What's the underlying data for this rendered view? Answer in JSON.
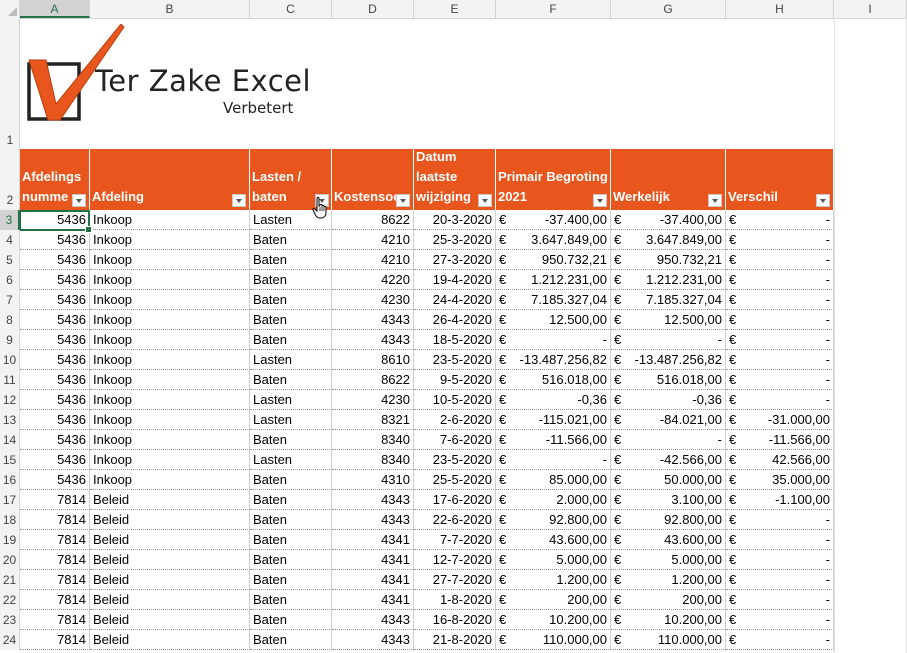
{
  "columns": [
    "A",
    "B",
    "C",
    "D",
    "E",
    "F",
    "G",
    "H",
    "I"
  ],
  "logo": {
    "title": "Ter Zake Excel",
    "subtitle": "Verbetert"
  },
  "headers": [
    "Afdelings\nnumme",
    "Afdeling",
    "Lasten /\nbaten",
    "Kostensoo",
    "Datum\nlaatste\nwijziging",
    "Primair Begroting\n2021",
    "Werkelijk",
    "Verschil"
  ],
  "rows": [
    {
      "n": "3",
      "afdnr": "5436",
      "afd": "Inkoop",
      "lb": "Lasten",
      "ks": "8622",
      "datum": "20-3-2020",
      "f": "-37.400,00",
      "g": "-37.400,00",
      "h": "-"
    },
    {
      "n": "4",
      "afdnr": "5436",
      "afd": "Inkoop",
      "lb": "Baten",
      "ks": "4210",
      "datum": "25-3-2020",
      "f": "3.647.849,00",
      "g": "3.647.849,00",
      "h": "-"
    },
    {
      "n": "5",
      "afdnr": "5436",
      "afd": "Inkoop",
      "lb": "Baten",
      "ks": "4210",
      "datum": "27-3-2020",
      "f": "950.732,21",
      "g": "950.732,21",
      "h": "-"
    },
    {
      "n": "6",
      "afdnr": "5436",
      "afd": "Inkoop",
      "lb": "Baten",
      "ks": "4220",
      "datum": "19-4-2020",
      "f": "1.212.231,00",
      "g": "1.212.231,00",
      "h": "-"
    },
    {
      "n": "7",
      "afdnr": "5436",
      "afd": "Inkoop",
      "lb": "Baten",
      "ks": "4230",
      "datum": "24-4-2020",
      "f": "7.185.327,04",
      "g": "7.185.327,04",
      "h": "-"
    },
    {
      "n": "8",
      "afdnr": "5436",
      "afd": "Inkoop",
      "lb": "Baten",
      "ks": "4343",
      "datum": "26-4-2020",
      "f": "12.500,00",
      "g": "12.500,00",
      "h": "-"
    },
    {
      "n": "9",
      "afdnr": "5436",
      "afd": "Inkoop",
      "lb": "Baten",
      "ks": "4343",
      "datum": "18-5-2020",
      "f": "-",
      "g": "-",
      "h": "-"
    },
    {
      "n": "10",
      "afdnr": "5436",
      "afd": "Inkoop",
      "lb": "Lasten",
      "ks": "8610",
      "datum": "23-5-2020",
      "f": "-13.487.256,82",
      "g": "-13.487.256,82",
      "h": "-"
    },
    {
      "n": "11",
      "afdnr": "5436",
      "afd": "Inkoop",
      "lb": "Baten",
      "ks": "8622",
      "datum": "9-5-2020",
      "f": "516.018,00",
      "g": "516.018,00",
      "h": "-"
    },
    {
      "n": "12",
      "afdnr": "5436",
      "afd": "Inkoop",
      "lb": "Lasten",
      "ks": "4230",
      "datum": "10-5-2020",
      "f": "-0,36",
      "g": "-0,36",
      "h": "-"
    },
    {
      "n": "13",
      "afdnr": "5436",
      "afd": "Inkoop",
      "lb": "Lasten",
      "ks": "8321",
      "datum": "2-6-2020",
      "f": "-115.021,00",
      "g": "-84.021,00",
      "h": "-31.000,00"
    },
    {
      "n": "14",
      "afdnr": "5436",
      "afd": "Inkoop",
      "lb": "Baten",
      "ks": "8340",
      "datum": "7-6-2020",
      "f": "-11.566,00",
      "g": "-",
      "h": "-11.566,00"
    },
    {
      "n": "15",
      "afdnr": "5436",
      "afd": "Inkoop",
      "lb": "Lasten",
      "ks": "8340",
      "datum": "23-5-2020",
      "f": "-",
      "g": "-42.566,00",
      "h": "42.566,00"
    },
    {
      "n": "16",
      "afdnr": "5436",
      "afd": "Inkoop",
      "lb": "Baten",
      "ks": "4310",
      "datum": "25-5-2020",
      "f": "85.000,00",
      "g": "50.000,00",
      "h": "35.000,00"
    },
    {
      "n": "17",
      "afdnr": "7814",
      "afd": "Beleid",
      "lb": "Baten",
      "ks": "4343",
      "datum": "17-6-2020",
      "f": "2.000,00",
      "g": "3.100,00",
      "h": "-1.100,00"
    },
    {
      "n": "18",
      "afdnr": "7814",
      "afd": "Beleid",
      "lb": "Baten",
      "ks": "4343",
      "datum": "22-6-2020",
      "f": "92.800,00",
      "g": "92.800,00",
      "h": "-"
    },
    {
      "n": "19",
      "afdnr": "7814",
      "afd": "Beleid",
      "lb": "Baten",
      "ks": "4341",
      "datum": "7-7-2020",
      "f": "43.600,00",
      "g": "43.600,00",
      "h": "-"
    },
    {
      "n": "20",
      "afdnr": "7814",
      "afd": "Beleid",
      "lb": "Baten",
      "ks": "4341",
      "datum": "12-7-2020",
      "f": "5.000,00",
      "g": "5.000,00",
      "h": "-"
    },
    {
      "n": "21",
      "afdnr": "7814",
      "afd": "Beleid",
      "lb": "Baten",
      "ks": "4341",
      "datum": "27-7-2020",
      "f": "1.200,00",
      "g": "1.200,00",
      "h": "-"
    },
    {
      "n": "22",
      "afdnr": "7814",
      "afd": "Beleid",
      "lb": "Baten",
      "ks": "4341",
      "datum": "1-8-2020",
      "f": "200,00",
      "g": "200,00",
      "h": "-"
    },
    {
      "n": "23",
      "afdnr": "7814",
      "afd": "Beleid",
      "lb": "Baten",
      "ks": "4343",
      "datum": "16-8-2020",
      "f": "10.200,00",
      "g": "10.200,00",
      "h": "-"
    },
    {
      "n": "24",
      "afdnr": "7814",
      "afd": "Beleid",
      "lb": "Baten",
      "ks": "4343",
      "datum": "21-8-2020",
      "f": "110.000,00",
      "g": "110.000,00",
      "h": "-"
    }
  ],
  "row_labels": {
    "r1": "1",
    "r2": "2"
  },
  "currency_symbol": "€",
  "colors": {
    "header_bg": "#e8561e",
    "header_text": "#ffffff",
    "selection": "#217346"
  }
}
